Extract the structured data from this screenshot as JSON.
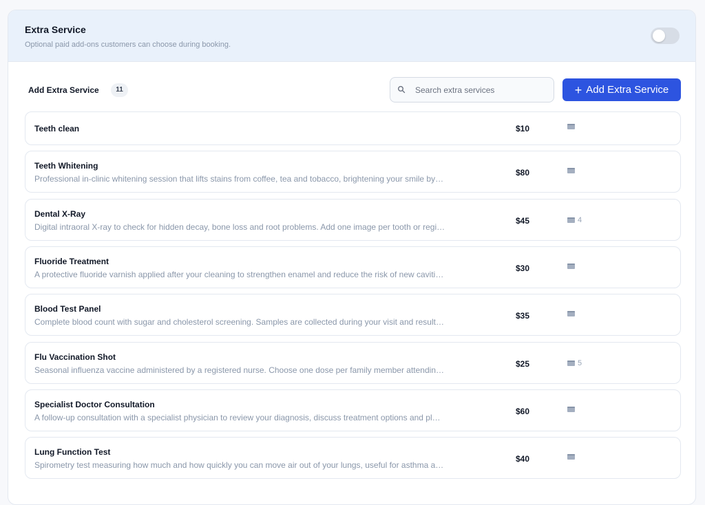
{
  "header": {
    "title": "Extra Service",
    "subtitle": "Optional paid add-ons customers can choose during booking.",
    "toggle_on": false
  },
  "toolbar": {
    "section_label": "Add Extra Service",
    "count": "11",
    "search_placeholder": "Search extra services",
    "search_value": "",
    "add_button_label": "Add Extra Service"
  },
  "icons": {
    "search": "search-icon",
    "media": "image-icon",
    "plus": "plus-icon"
  },
  "colors": {
    "accent": "#2d54e0",
    "header_bg": "#e9f1fb",
    "muted_text": "#8a97aa"
  },
  "services": [
    {
      "name": "Teeth clean",
      "description": "",
      "price": "$10",
      "media_count": ""
    },
    {
      "name": "Teeth Whitening",
      "description": "Professional in-clinic whitening session that lifts stains from coffee, tea and tobacco, brightening your smile by…",
      "price": "$80",
      "media_count": ""
    },
    {
      "name": "Dental X-Ray",
      "description": "Digital intraoral X-ray to check for hidden decay, bone loss and root problems. Add one image per tooth or regi…",
      "price": "$45",
      "media_count": "4"
    },
    {
      "name": "Fluoride Treatment",
      "description": "A protective fluoride varnish applied after your cleaning to strengthen enamel and reduce the risk of new caviti…",
      "price": "$30",
      "media_count": ""
    },
    {
      "name": "Blood Test Panel",
      "description": "Complete blood count with sugar and cholesterol screening. Samples are collected during your visit and result…",
      "price": "$35",
      "media_count": ""
    },
    {
      "name": "Flu Vaccination Shot",
      "description": "Seasonal influenza vaccine administered by a registered nurse. Choose one dose per family member attendin…",
      "price": "$25",
      "media_count": "5"
    },
    {
      "name": "Specialist Doctor Consultation",
      "description": "A follow-up consultation with a specialist physician to review your diagnosis, discuss treatment options and pl…",
      "price": "$60",
      "media_count": ""
    },
    {
      "name": "Lung Function Test",
      "description": "Spirometry test measuring how much and how quickly you can move air out of your lungs, useful for asthma a…",
      "price": "$40",
      "media_count": ""
    }
  ]
}
